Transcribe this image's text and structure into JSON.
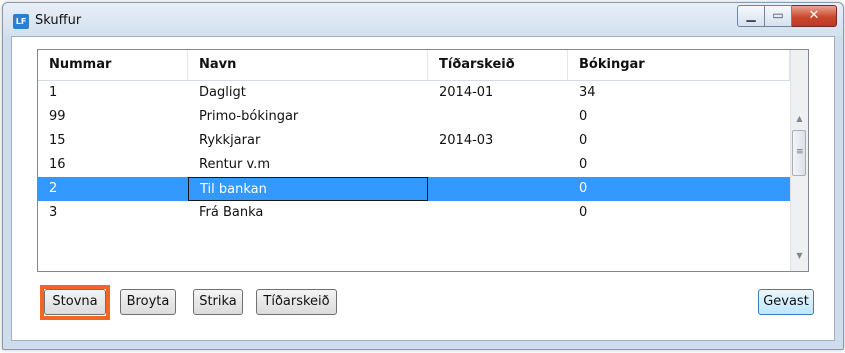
{
  "window": {
    "title": "Skuffur",
    "icon_label": "LF",
    "caption_buttons": {
      "minimize": "minimize-icon",
      "maximize": "maximize-icon",
      "close": "close-icon"
    }
  },
  "grid": {
    "columns": [
      "Nummar",
      "Navn",
      "Tíðarskeið",
      "Bókingar"
    ],
    "rows": [
      [
        "1",
        "Dagligt",
        "2014-01",
        "34"
      ],
      [
        "99",
        "Primo-bókingar",
        "",
        "0"
      ],
      [
        "15",
        "Rykkjarar",
        "2014-03",
        "0"
      ],
      [
        "16",
        "Rentur v.m",
        "",
        "0"
      ],
      [
        "2",
        "Til bankan",
        "",
        "0"
      ],
      [
        "3",
        "Frá Banka",
        "",
        "0"
      ]
    ],
    "selected_row_index": 4
  },
  "buttons": {
    "stovna": "Stovna",
    "broyta": "Broyta",
    "strika": "Strika",
    "tidarskeid": "Tíðarskeið",
    "gevast": "Gevast"
  },
  "colors": {
    "selection": "#3399ff",
    "highlight_outline": "#f26522"
  }
}
